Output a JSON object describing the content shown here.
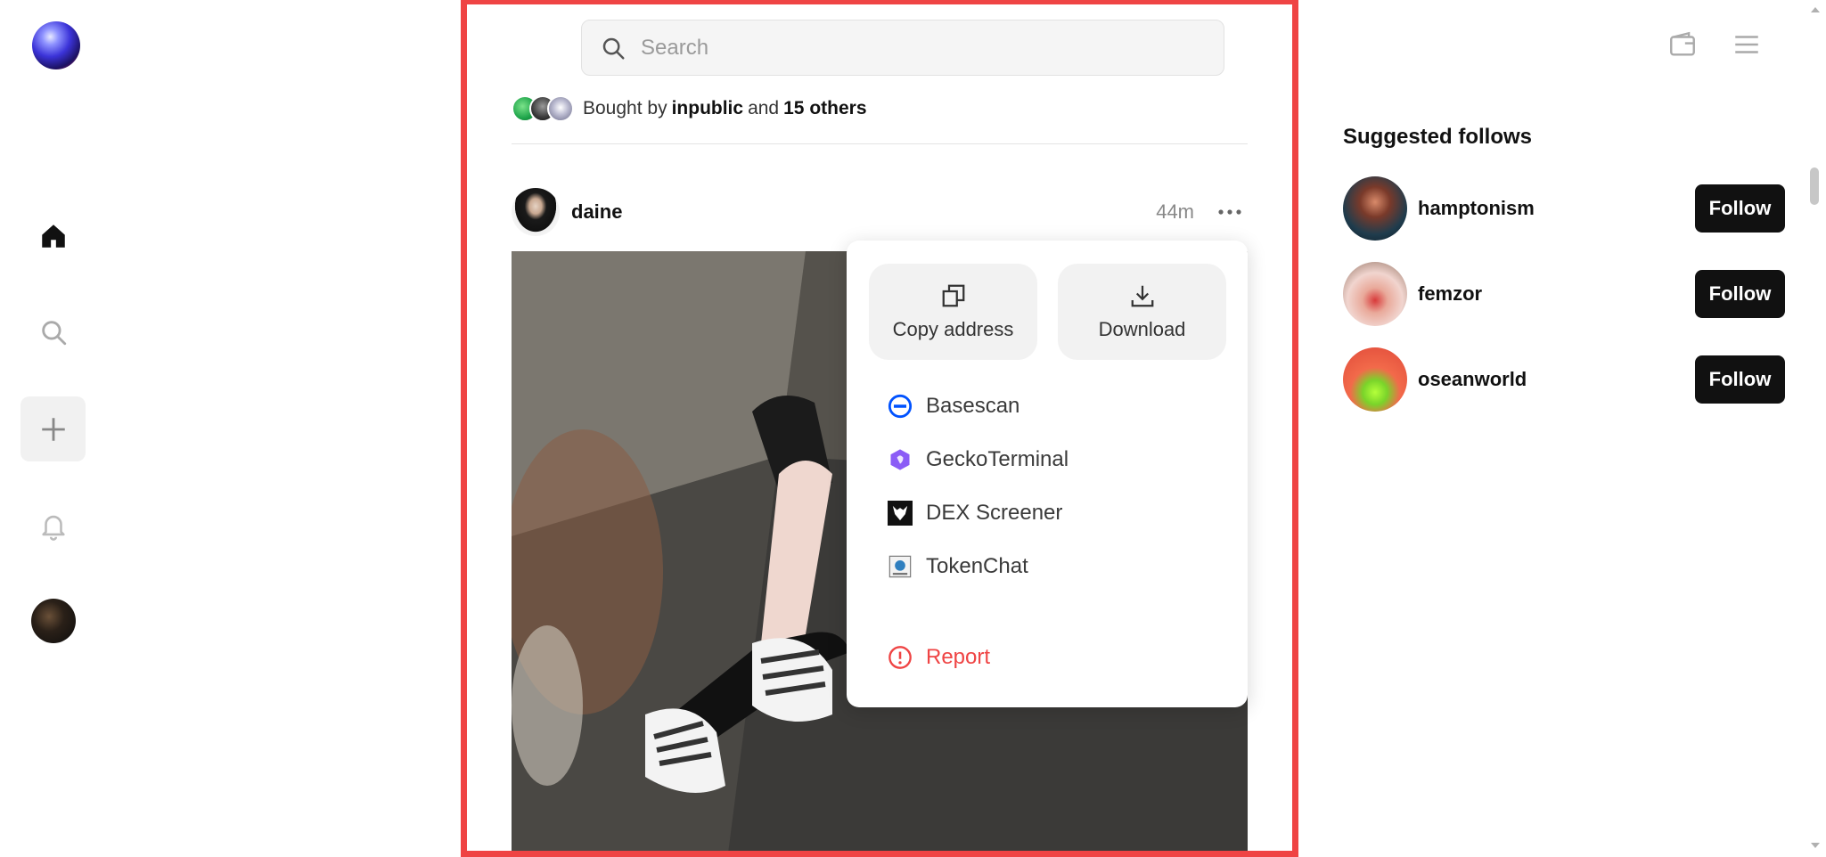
{
  "search": {
    "placeholder": "Search"
  },
  "activity": {
    "prefix": "Bought by",
    "user": "inpublic",
    "conjunction": "and",
    "others": "15 others"
  },
  "post": {
    "username": "daine",
    "time": "44m"
  },
  "menu": {
    "copy_address": "Copy address",
    "download": "Download",
    "links": [
      "Basescan",
      "GeckoTerminal",
      "DEX Screener",
      "TokenChat"
    ],
    "report": "Report"
  },
  "suggested": {
    "title": "Suggested follows",
    "users": [
      {
        "name": "hamptonism",
        "button": "Follow"
      },
      {
        "name": "femzor",
        "button": "Follow"
      },
      {
        "name": "oseanworld",
        "button": "Follow"
      }
    ]
  },
  "colors": {
    "accent_red": "#ef4444",
    "button_dark": "#111111",
    "basescan_blue": "#0052ff",
    "gecko_purple": "#8b5cf6"
  },
  "icons": {
    "nav": [
      "home-icon",
      "search-icon",
      "plus-icon",
      "bell-icon"
    ],
    "top_right": [
      "wallet-icon",
      "menu-icon"
    ]
  }
}
